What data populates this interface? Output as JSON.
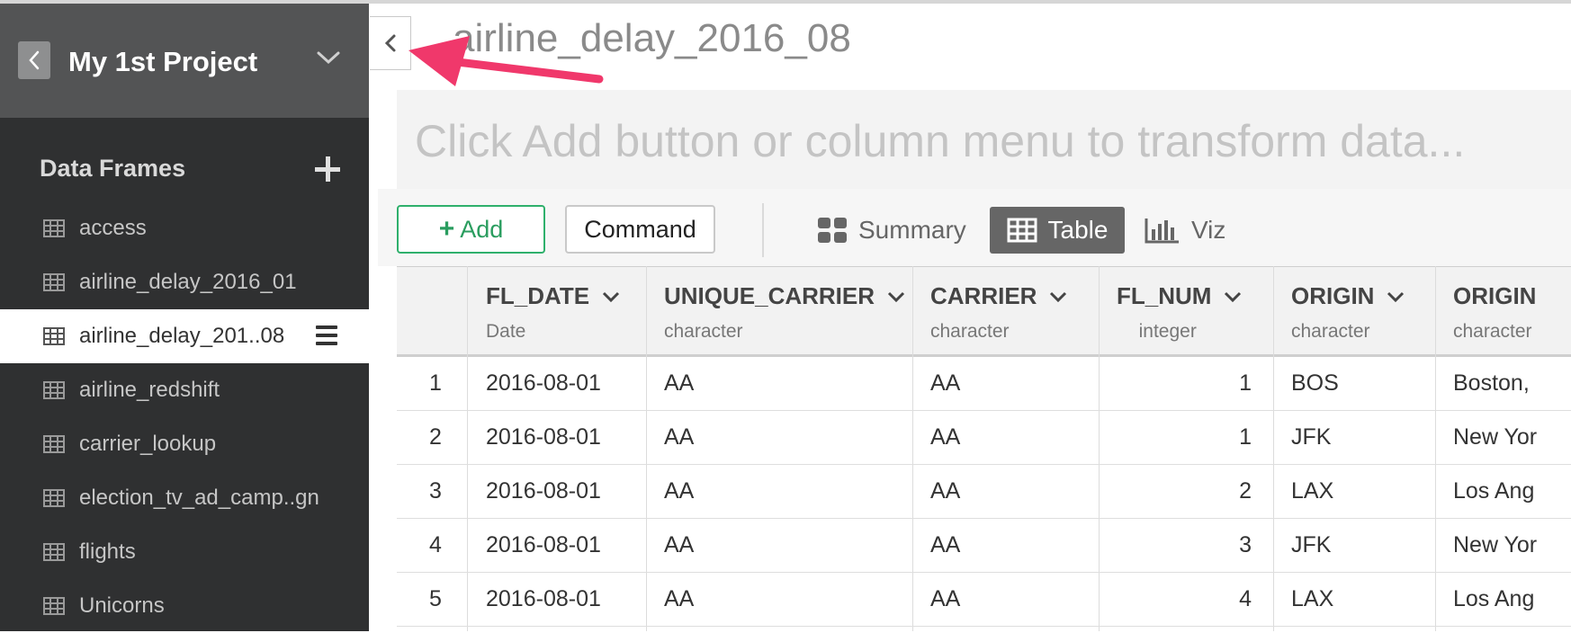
{
  "sidebar": {
    "project_title": "My 1st Project",
    "section_title": "Data Frames",
    "items": [
      {
        "label": "access"
      },
      {
        "label": "airline_delay_2016_01"
      },
      {
        "label": "airline_delay_201..08",
        "active": true
      },
      {
        "label": "airline_redshift"
      },
      {
        "label": "carrier_lookup"
      },
      {
        "label": "election_tv_ad_camp..gn"
      },
      {
        "label": "flights"
      },
      {
        "label": "Unicorns"
      }
    ]
  },
  "main": {
    "title": "airline_delay_2016_08",
    "hint": "Click Add button or column menu to transform data..."
  },
  "toolbar": {
    "add_label": "Add",
    "command_label": "Command",
    "views": {
      "summary": "Summary",
      "table": "Table",
      "viz": "Viz"
    },
    "active_view": "Table"
  },
  "table": {
    "columns": [
      {
        "name": "FL_DATE",
        "type": "Date"
      },
      {
        "name": "UNIQUE_CARRIER",
        "type": "character"
      },
      {
        "name": "CARRIER",
        "type": "character"
      },
      {
        "name": "FL_NUM",
        "type": "integer"
      },
      {
        "name": "ORIGIN",
        "type": "character"
      },
      {
        "name": "ORIGIN",
        "type": "character"
      }
    ],
    "rows": [
      {
        "n": "1",
        "cells": [
          "2016-08-01",
          "AA",
          "AA",
          "1",
          "BOS",
          "Boston,"
        ]
      },
      {
        "n": "2",
        "cells": [
          "2016-08-01",
          "AA",
          "AA",
          "1",
          "JFK",
          "New Yor"
        ]
      },
      {
        "n": "3",
        "cells": [
          "2016-08-01",
          "AA",
          "AA",
          "2",
          "LAX",
          "Los Ang"
        ]
      },
      {
        "n": "4",
        "cells": [
          "2016-08-01",
          "AA",
          "AA",
          "3",
          "JFK",
          "New Yor"
        ]
      },
      {
        "n": "5",
        "cells": [
          "2016-08-01",
          "AA",
          "AA",
          "4",
          "LAX",
          "Los Ang"
        ]
      }
    ]
  },
  "colors": {
    "sidebar_bg": "#2f3031",
    "project_header_bg": "#535455",
    "add_accent": "#2fb06c",
    "annotation_arrow": "#f0386b"
  },
  "icons": [
    "chevron-left-icon",
    "chevron-down-icon",
    "plus-icon",
    "table-grid-icon",
    "hamburger-menu-icon",
    "summary-tiles-icon",
    "bar-chart-icon",
    "annotation-arrow"
  ]
}
